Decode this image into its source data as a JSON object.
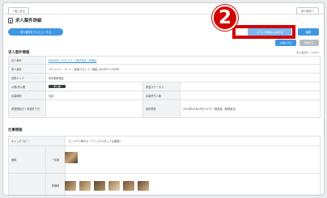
{
  "header": {
    "back_label": "一覧に戻る",
    "top_right_label": "求人案件へ"
  },
  "page": {
    "title": "求人案件詳細"
  },
  "toolbar": {
    "preview_label": "求人案件をプレビューする",
    "highlight_label": "ステップ登録を公開する",
    "edit_label": "編集",
    "action_a_label": "公開にする",
    "action_b_label": "複製する",
    "step_number": "2"
  },
  "info_section": {
    "title": "求人案件情報",
    "meta": "求人案件ID：23456",
    "rows": [
      {
        "label": "法人番号",
        "value": "KAKAMA 1103 テスト 株式会社 / 新宿店"
      },
      {
        "label": "求人案件",
        "value": "アルバイト・パート / 飲食スタッフ / 時給 1200円〜1350円"
      },
      {
        "label": "勤務エリア",
        "value": "東京都新宿区"
      },
      {
        "label": "公開/非公開",
        "value": "非公開",
        "label2": "掲載ステータス",
        "value2": ""
      },
      {
        "label": "応募期間",
        "value": "未定",
        "label2": "応募受付人数",
        "value2": ""
      },
      {
        "label": "掲載開始日 / 掲載終了日",
        "value": "",
        "label2": "最終更新",
        "value2": "2023年02月09日 10:37 / 更新者（管理者名）"
      }
    ]
  },
  "work_section": {
    "title": "仕事情報",
    "rows": [
      {
        "label": "キャッチコピー",
        "value": "ゴールデン帯のオープニングスタッフ大募集！"
      },
      {
        "label": "画像",
        "sub": "一覧用",
        "value": ""
      },
      {
        "label": "",
        "sub": "詳細用",
        "value": ""
      }
    ]
  }
}
